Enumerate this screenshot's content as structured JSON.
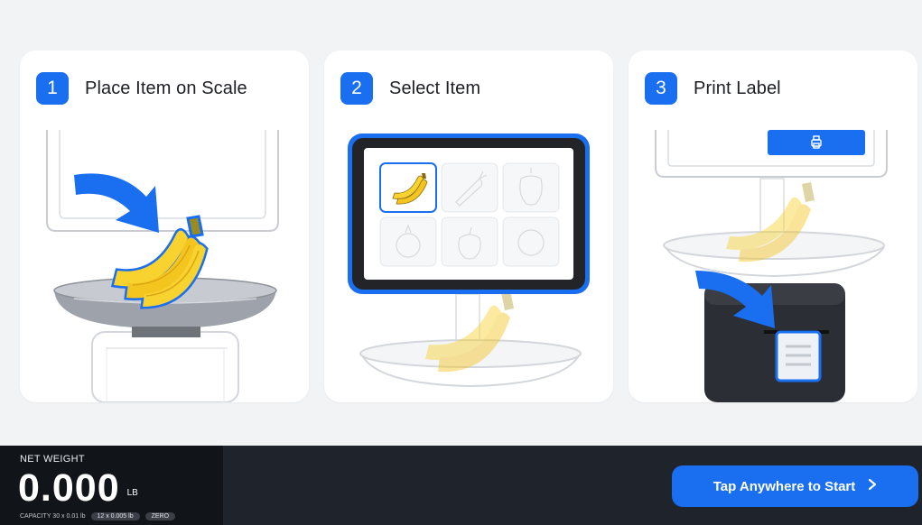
{
  "steps": [
    {
      "number": "1",
      "title": "Place Item on Scale"
    },
    {
      "number": "2",
      "title": "Select Item"
    },
    {
      "number": "3",
      "title": "Print Label"
    }
  ],
  "weight": {
    "label": "NET WEIGHT",
    "value": "0.000",
    "unit": "LB",
    "capacity": "CAPACITY 30 x 0.01 lb",
    "division": "12 x 0.005 lb",
    "zero": "ZERO"
  },
  "start_button": {
    "label": "Tap Anywhere to Start",
    "icon": "chevron-right-icon"
  },
  "colors": {
    "accent": "#1a6ef0",
    "banana": "#f8d22f",
    "bar": "#1f232b"
  },
  "item_grid": [
    "banana-icon",
    "carrot-icon",
    "pepper-icon",
    "onion-icon",
    "apple-icon",
    "orange-icon"
  ]
}
